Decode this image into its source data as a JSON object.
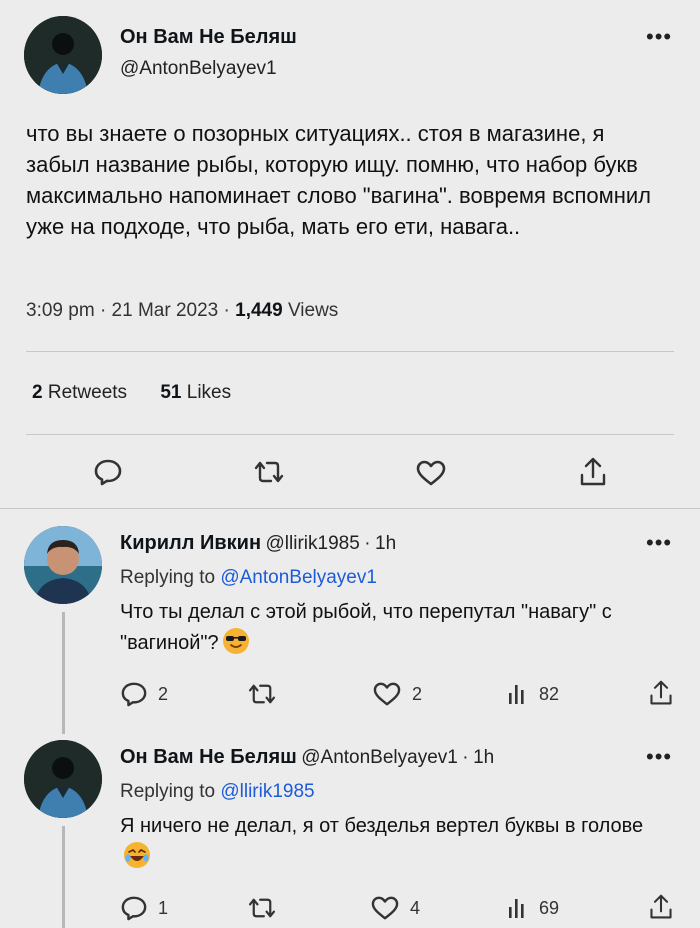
{
  "main_tweet": {
    "author_name": "Он Вам Не Беляш",
    "author_handle": "@AntonBelyayev1",
    "text": "что вы знаете о позорных ситуациях.. стоя в магазине, я забыл название рыбы, которую ищу. помню, что набор букв максимально напоминает слово \"вагина\". вовремя вспомнил уже на подходе, что рыба, мать его ети, навага..",
    "time": "3:09 pm",
    "date": "21 Mar 2023",
    "views_count": "1,449",
    "views_label": "Views",
    "retweets_count": "2",
    "retweets_label": "Retweets",
    "likes_count": "51",
    "likes_label": "Likes"
  },
  "replies": [
    {
      "author_name": "Кирилл Ивкин",
      "author_handle": "@llirik1985",
      "age": "1h",
      "replying_label": "Replying to",
      "replying_to": "@AntonBelyayev1",
      "text": "Что ты делал с этой рыбой, что перепутал \"навагу\" с \"вагиной\"?",
      "emoji": "smiling-face-with-sunglasses",
      "replies_count": "2",
      "likes_count": "2",
      "views_count": "82"
    },
    {
      "author_name": "Он Вам Не Беляш",
      "author_handle": "@AntonBelyayev1",
      "age": "1h",
      "replying_label": "Replying to",
      "replying_to": "@llirik1985",
      "text": "Я ничего не делал, я от безделья вертел буквы в голове",
      "emoji": "rolling-on-floor-laughing",
      "replies_count": "1",
      "likes_count": "4",
      "views_count": "69"
    }
  ],
  "colors": {
    "background": "#ececec",
    "link": "#1d5bd8",
    "text": "#0f1419",
    "divider": "#c8c8c8"
  },
  "icons": {
    "more": "more-dots-icon",
    "reply": "reply-bubble-icon",
    "retweet": "retweet-icon",
    "like": "heart-icon",
    "share": "share-icon",
    "views": "views-bar-chart-icon"
  }
}
